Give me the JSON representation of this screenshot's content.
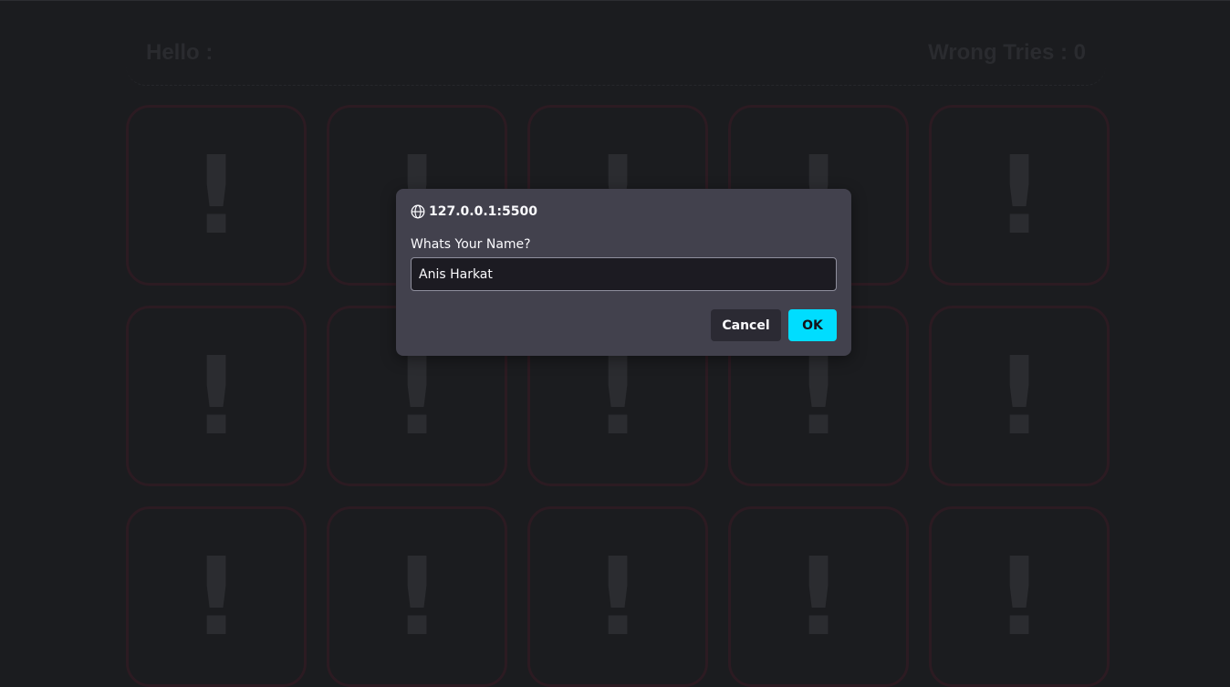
{
  "header": {
    "hello_label": "Hello :",
    "wrong_tries_label": "Wrong Tries : 0"
  },
  "cards": [
    "!",
    "!",
    "!",
    "!",
    "!",
    "!",
    "!",
    "!",
    "!",
    "!",
    "!",
    "!",
    "!",
    "!",
    "!"
  ],
  "dialog": {
    "origin": "127.0.0.1:5500",
    "origin_icon": "globe-icon",
    "message": "Whats Your Name?",
    "input_value": "Anis Harkat",
    "cancel_label": "Cancel",
    "ok_label": "OK"
  },
  "colors": {
    "background": "#1b1c1f",
    "dialog_bg": "#42414d",
    "ok_accent": "#00ddff",
    "card_border": "#2c1b22"
  }
}
